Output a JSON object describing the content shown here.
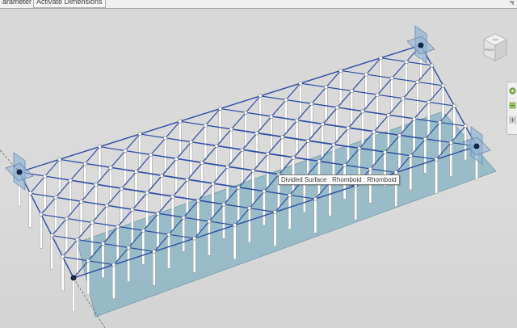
{
  "toolbar": {
    "parameter_label": "arameter",
    "activate_dimensions_label": "Activate Dimensions"
  },
  "viewport": {
    "tooltip": "Divided Surface : Rhomboid : Rhomboid"
  },
  "viewcube": {
    "top_label": "TOP",
    "front_label": "FRONT"
  },
  "colors": {
    "grid_line": "#2a4da6",
    "surface_fill": "#7fb0c0",
    "column": "#ffffff",
    "reference_plane": "#8fb3d6"
  },
  "icons": [
    "viewcube-icon",
    "steering-wheel-icon",
    "zoom-icon"
  ]
}
